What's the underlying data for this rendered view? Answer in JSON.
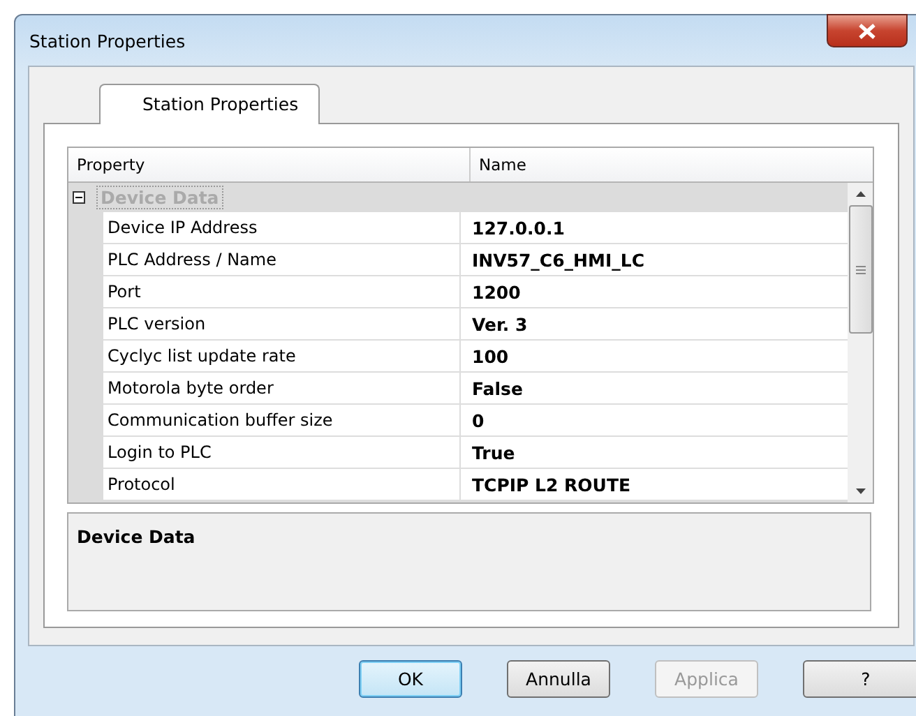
{
  "window": {
    "title": "Station Properties"
  },
  "tabs": [
    {
      "label": "Station Properties",
      "selected": true
    }
  ],
  "grid": {
    "columns": [
      "Property",
      "Name"
    ],
    "group": {
      "label": "Device Data",
      "expanded": true
    },
    "rows": [
      {
        "property": "Device IP Address",
        "value": "127.0.0.1"
      },
      {
        "property": "PLC Address / Name",
        "value": "INV57_C6_HMI_LC"
      },
      {
        "property": "Port",
        "value": "1200"
      },
      {
        "property": "PLC version",
        "value": "Ver. 3"
      },
      {
        "property": "Cyclyc list update rate",
        "value": "100"
      },
      {
        "property": "Motorola byte order",
        "value": "False"
      },
      {
        "property": "Communication buffer size",
        "value": "0"
      },
      {
        "property": "Login to PLC",
        "value": "True"
      },
      {
        "property": "Protocol",
        "value": "TCPIP L2 ROUTE"
      }
    ]
  },
  "description": {
    "title": "Device Data"
  },
  "buttons": [
    {
      "label": "OK",
      "default": true,
      "disabled": false
    },
    {
      "label": "Annulla",
      "default": false,
      "disabled": false
    },
    {
      "label": "Applica",
      "default": false,
      "disabled": true
    },
    {
      "label": "?",
      "default": false,
      "disabled": false
    }
  ]
}
